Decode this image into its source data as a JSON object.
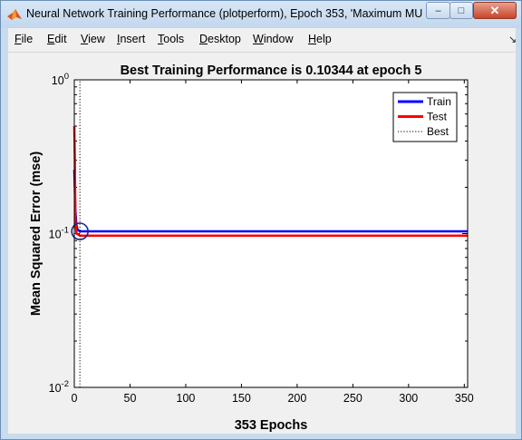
{
  "window": {
    "title": "Neural Network Training Performance (plotperform), Epoch 353, 'Maximum MU ...",
    "minimize_glyph": "–",
    "maximize_glyph": "□",
    "close_glyph": "✕",
    "app_icon": "matlab-logo-icon"
  },
  "menu": {
    "items": [
      "File",
      "Edit",
      "View",
      "Insert",
      "Tools",
      "Desktop",
      "Window",
      "Help"
    ],
    "dock_glyph": "↘"
  },
  "colors": {
    "train": "#0000ff",
    "test": "#ff0000",
    "best": "#000000",
    "axes_bg": "#ffffff",
    "figure_bg": "#f0f0f0"
  },
  "chart_data": {
    "type": "line",
    "title": "Best Training Performance is 0.10344 at epoch 5",
    "xlabel": "353 Epochs",
    "ylabel": "Mean Squared Error  (mse)",
    "xlim": [
      0,
      353
    ],
    "ylim": [
      0.01,
      1
    ],
    "yscale": "log",
    "grid": false,
    "legend_position": "top-right",
    "xticks": [
      0,
      50,
      100,
      150,
      200,
      250,
      300,
      350
    ],
    "yticks": [
      {
        "value": 1,
        "base": "10",
        "exp": "0"
      },
      {
        "value": 0.1,
        "base": "10",
        "exp": "-1"
      },
      {
        "value": 0.01,
        "base": "10",
        "exp": "-2"
      }
    ],
    "series": [
      {
        "name": "Train",
        "style": "solid",
        "x": [
          0,
          1,
          2,
          3,
          5,
          353
        ],
        "y": [
          0.26,
          0.14,
          0.112,
          0.106,
          0.10344,
          0.10344
        ]
      },
      {
        "name": "Test",
        "style": "solid",
        "x": [
          0,
          0.5,
          1,
          2,
          3,
          5,
          353
        ],
        "y": [
          0.5,
          0.3,
          0.12,
          0.1,
          0.099,
          0.097,
          0.097
        ]
      },
      {
        "name": "Best",
        "style": "dotted",
        "x": [
          5,
          5
        ],
        "y": [
          0.01,
          1
        ]
      }
    ],
    "best_marker": {
      "x": 5,
      "y": 0.10344
    }
  }
}
